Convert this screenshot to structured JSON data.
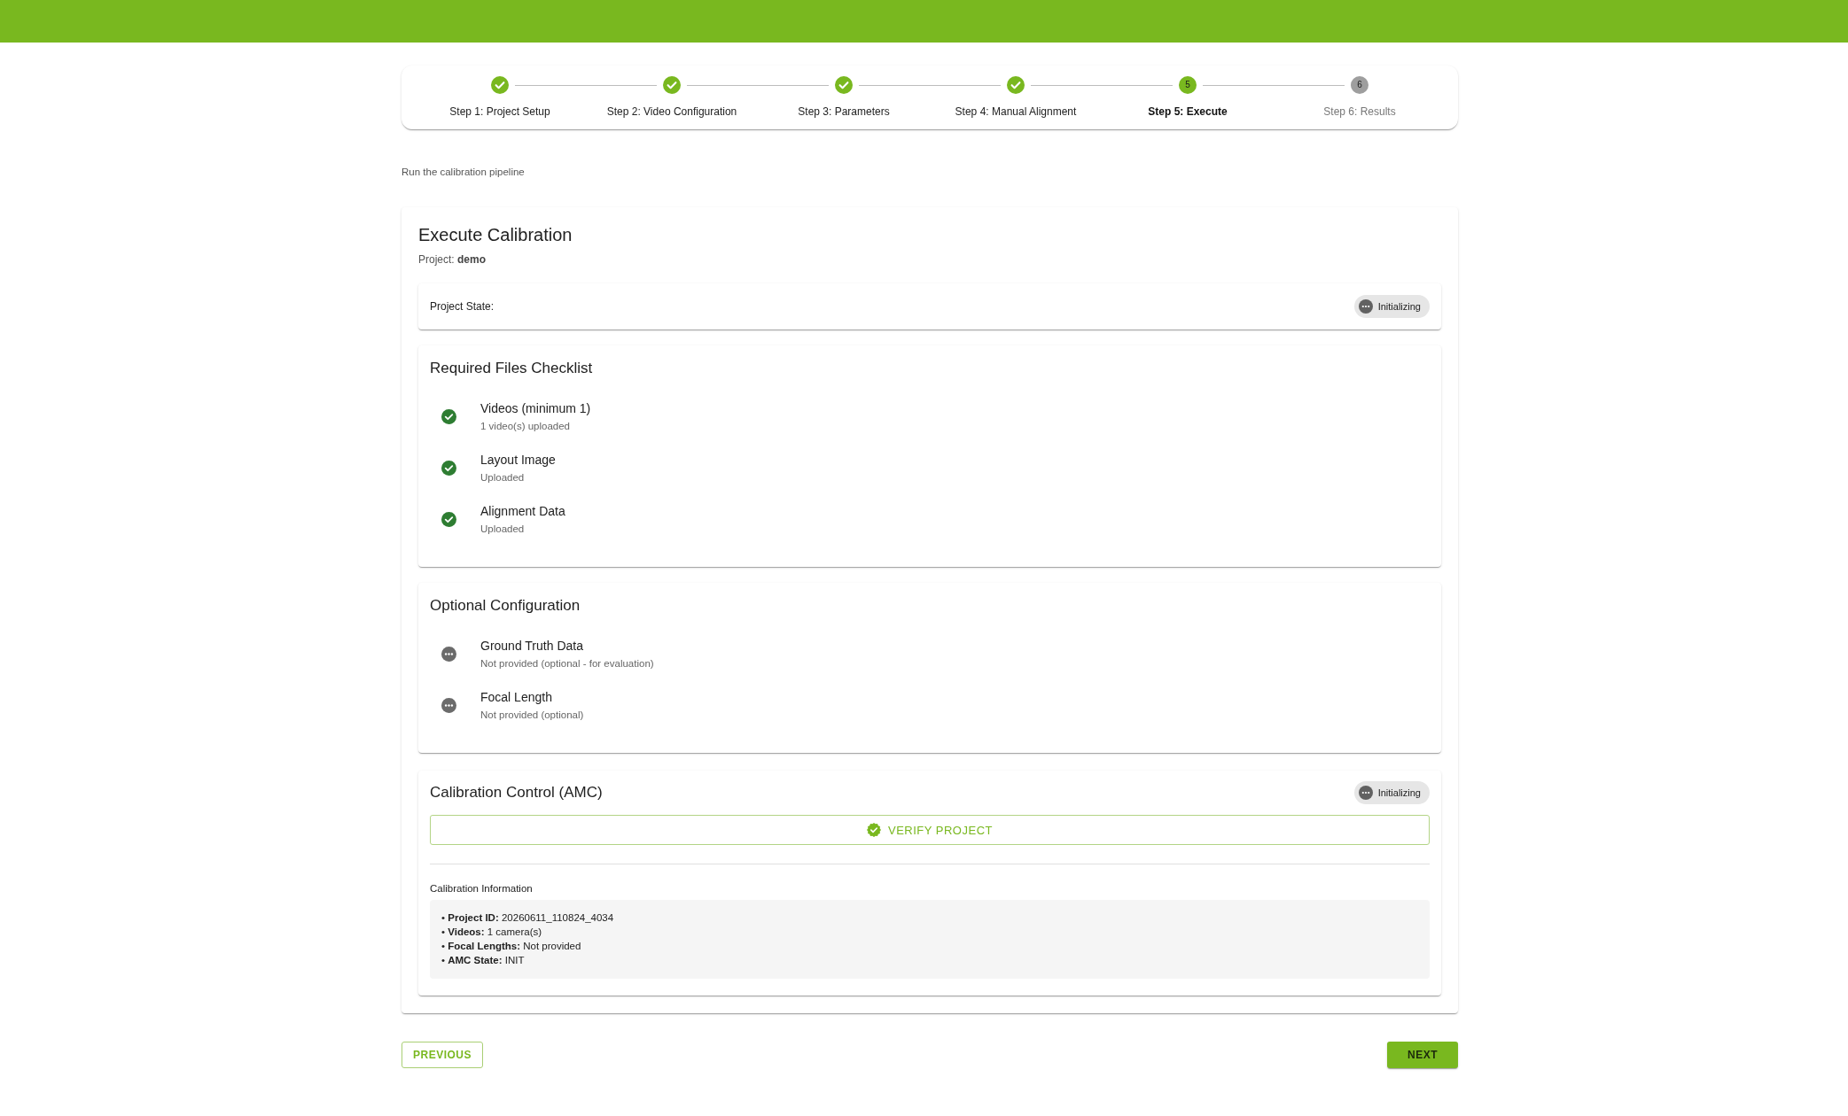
{
  "stepper": {
    "steps": [
      {
        "label": "Step 1: Project Setup",
        "completed": true,
        "selected": false
      },
      {
        "label": "Step 2: Video Configuration",
        "completed": true,
        "selected": false
      },
      {
        "label": "Step 3: Parameters",
        "completed": true,
        "selected": false
      },
      {
        "label": "Step 4: Manual Alignment",
        "completed": true,
        "selected": false
      },
      {
        "label": "Step 5: Execute",
        "completed": false,
        "selected": true,
        "number": "5"
      },
      {
        "label": "Step 6: Results",
        "completed": false,
        "selected": false,
        "number": "6"
      }
    ]
  },
  "subtitle": "Run the calibration pipeline",
  "execute_card": {
    "title": "Execute Calibration",
    "project": "Project: **demo**",
    "project_state": {
      "label": "Project State:",
      "chip": {
        "label": "Initializing"
      }
    },
    "required_files": {
      "title": "Required Files Checklist",
      "items": [
        {
          "name": "Videos (minimum 1)",
          "detail": "1 video(s) uploaded",
          "provided": true
        },
        {
          "name": "Layout Image",
          "detail": "Uploaded",
          "provided": true
        },
        {
          "name": "Alignment Data",
          "detail": "Uploaded",
          "provided": true
        }
      ]
    },
    "optional_configuration": {
      "title": "Optional Configuration",
      "items": [
        {
          "name": "Ground Truth Data",
          "detail": "Not provided (optional - for evaluation)",
          "provided": false
        },
        {
          "name": "Focal Length",
          "detail": "Not provided (optional)",
          "provided": false
        }
      ]
    },
    "calibration_control": {
      "title": "Calibration Control (AMC)",
      "chip": {
        "label": "Initializing"
      },
      "verify_button": "VERIFY PROJECT",
      "info_title": "Calibration Information",
      "info_lines": [
        "• **Project ID:** 20260611_110824_4034",
        "• **Videos:** 1 camera(s)",
        "• **Focal Lengths:** Not provided",
        "• **AMC State:** INIT"
      ]
    }
  },
  "buttons": [
    {
      "label": "PREVIOUS",
      "kind": "outlined"
    },
    {
      "label": "NEXT",
      "kind": "contained"
    }
  ]
}
